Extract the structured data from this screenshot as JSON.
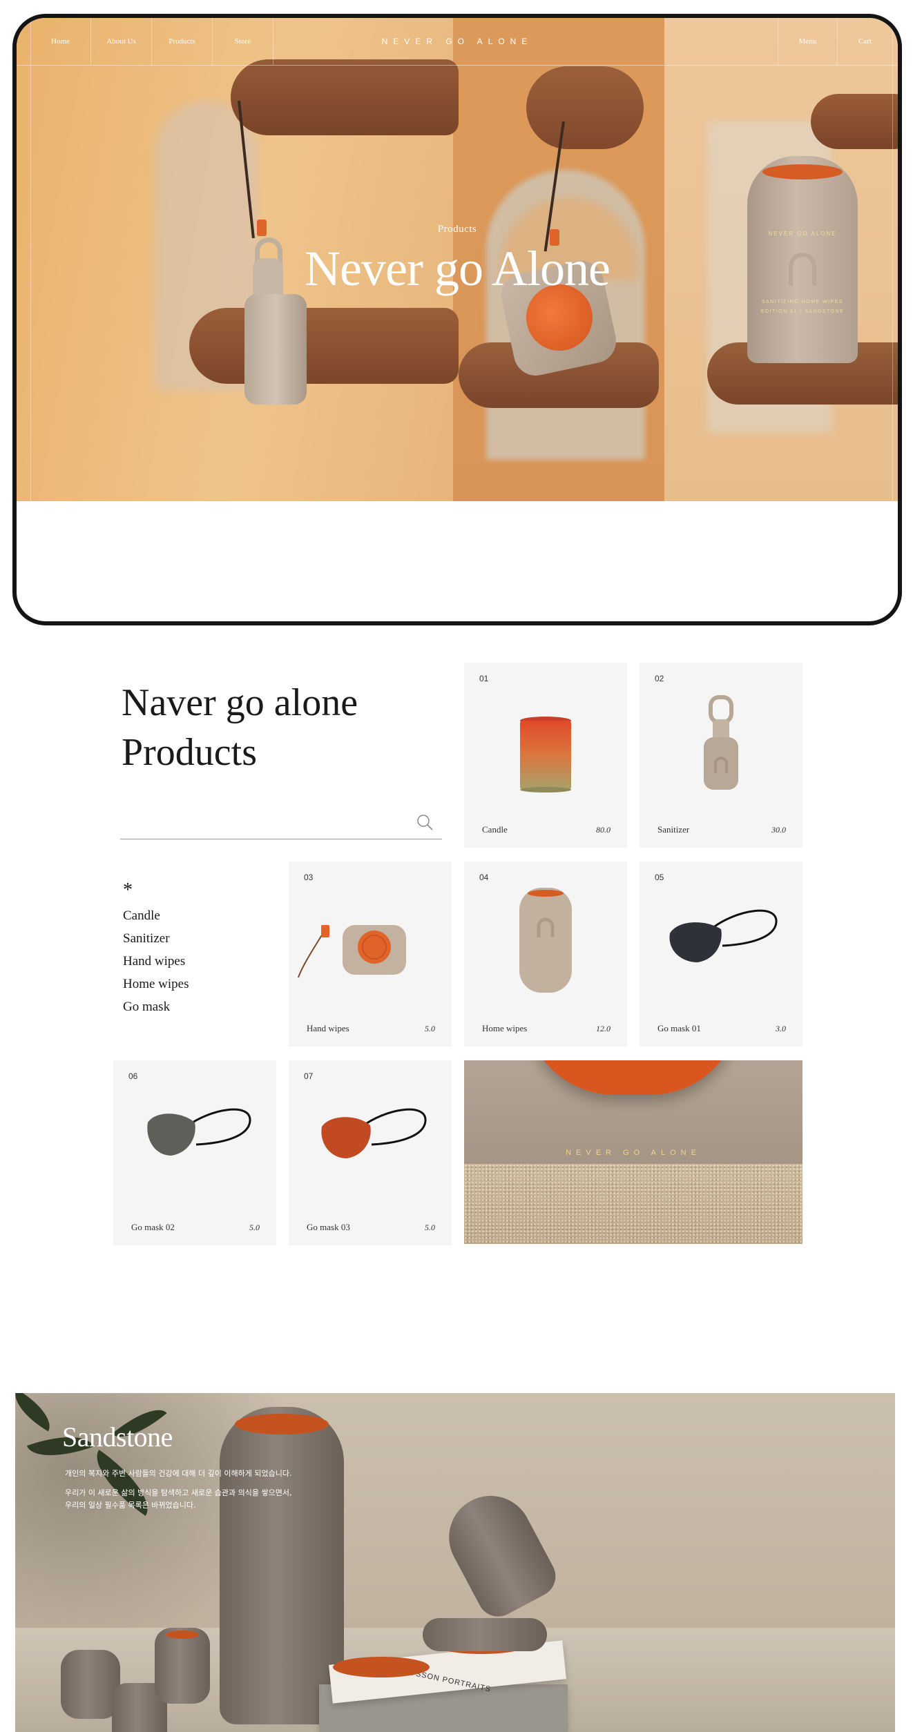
{
  "nav": {
    "left": [
      "Home",
      "About Us",
      "Products",
      "Store"
    ],
    "brand": "NEVER GO ALONE",
    "right": [
      "Menu",
      "Cart"
    ]
  },
  "hero": {
    "subtitle": "Products",
    "title": "Never go Alone",
    "canister_text_1": "NEVER GO ALONE",
    "canister_text_2": "SANITIZING HOME WIPES",
    "canister_text_3": "EDITION 01 / SANDSTONE"
  },
  "products": {
    "title_line1": "Naver go alone",
    "title_line2": "Products",
    "search_placeholder": "",
    "categories_marker": "*",
    "categories": [
      "Candle",
      "Sanitizer",
      "Hand wipes",
      "Home wipes",
      "Go mask"
    ],
    "items": [
      {
        "num": "01",
        "name": "Candle",
        "price": "80.0"
      },
      {
        "num": "02",
        "name": "Sanitizer",
        "price": "30.0"
      },
      {
        "num": "03",
        "name": "Hand wipes",
        "price": "5.0"
      },
      {
        "num": "04",
        "name": "Home wipes",
        "price": "12.0"
      },
      {
        "num": "05",
        "name": "Go mask 01",
        "price": "3.0"
      },
      {
        "num": "06",
        "name": "Go mask 02",
        "price": "5.0"
      },
      {
        "num": "07",
        "name": "Go mask 03",
        "price": "5.0"
      }
    ],
    "promo_text": "NEVER GO ALONE"
  },
  "banner": {
    "title": "Sandstone",
    "desc_1": "개인의 복지와 주변 사람들의 건강에 대해 더 깊이 이해하게 되었습니다.",
    "desc_2": "우리가 이 새로운 삶의 방식을 탐색하고 새로운 습관과 의식을 쌓으면서,",
    "desc_3": "우리의 일상 필수품 목록은 바뀌었습니다.",
    "book_text": "CARL BENGTSSON PORTRAITS"
  },
  "colors": {
    "accent": "#e0632a",
    "hero_left": "#efc48a",
    "hero_mid": "#dc9a5a",
    "card_bg": "#f5f5f5",
    "frame": "#141414"
  }
}
